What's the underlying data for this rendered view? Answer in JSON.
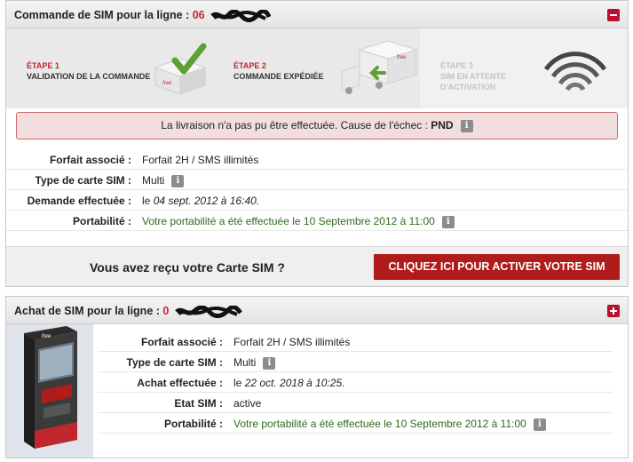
{
  "panel1": {
    "title": "Commande de SIM pour la ligne : ",
    "line_prefix": "06",
    "steps": [
      {
        "num": "ÉTAPE 1",
        "label": "VALIDATION DE LA COMMANDE"
      },
      {
        "num": "ÉTAPE 2",
        "label": "COMMANDE EXPÉDIÉE"
      },
      {
        "num": "ÉTAPE 3",
        "label_line1": "SIM EN ATTENTE",
        "label_line2": "D'ACTIVATION"
      }
    ],
    "alert_text": "La livraison n'a pas pu être effectuée. Cause de l'échec : ",
    "alert_cause": "PND",
    "rows": [
      {
        "label": "Forfait associé :",
        "value": "Forfait 2H / SMS illimités"
      },
      {
        "label": "Type de carte SIM :",
        "value": "Multi"
      },
      {
        "label": "Demande effectuée :",
        "prefix": "le ",
        "value": "04 sept. 2012 à 16:40."
      },
      {
        "label": "Portabilité :",
        "value": "Votre portabilité a été effectuée le 10 Septembre 2012 à 11:00"
      }
    ],
    "activate_question": "Vous avez reçu votre Carte SIM ?",
    "activate_button": "CLIQUEZ ICI POUR ACTIVER VOTRE SIM"
  },
  "panel2": {
    "title": "Achat de SIM pour la ligne : ",
    "line_prefix": "0",
    "rows": [
      {
        "label": "Forfait associé :",
        "value": "Forfait 2H / SMS illimités"
      },
      {
        "label": "Type de carte SIM :",
        "value": "Multi"
      },
      {
        "label": "Achat effectuée :",
        "prefix": "le ",
        "value": "22 oct. 2018 à 10:25."
      },
      {
        "label": "Etat SIM :",
        "value": "active"
      },
      {
        "label": "Portabilité :",
        "value": "Votre portabilité a été effectuée le 10 Septembre 2012 à 11:00"
      }
    ]
  },
  "info_icon": "i",
  "colors": {
    "accent": "#c0272d",
    "button": "#b01c1c",
    "green_text": "#2d6b1d",
    "alert_bg": "#f2dede"
  }
}
